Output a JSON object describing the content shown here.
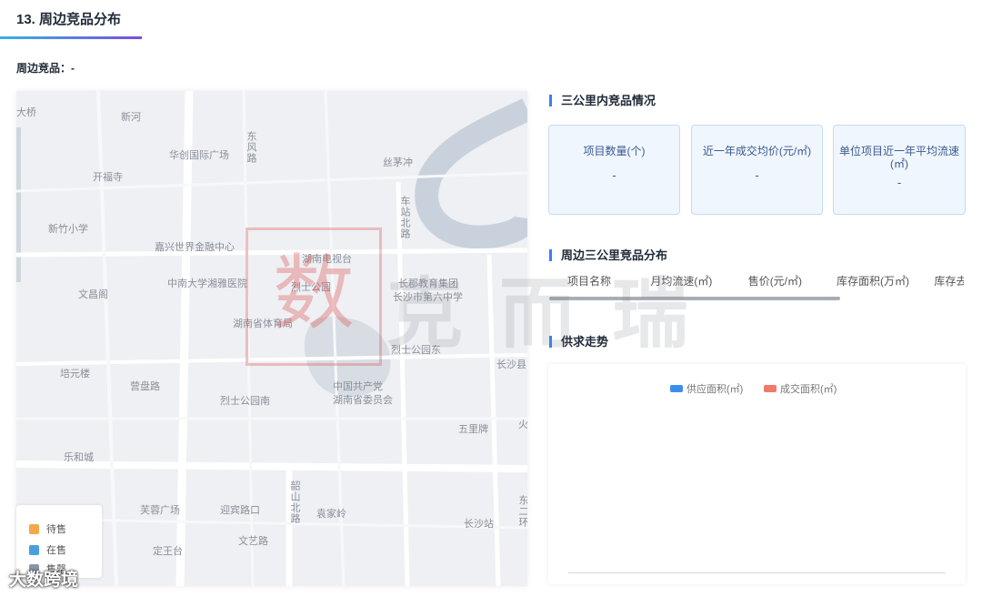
{
  "section": {
    "title": "13. 周边竞品分布"
  },
  "competitor_label": "周边竞品：-",
  "map": {
    "labels": [
      {
        "text": "大桥"
      },
      {
        "text": "新河"
      },
      {
        "text": "华创国际广场"
      },
      {
        "text": "东风路"
      },
      {
        "text": "开福寺"
      },
      {
        "text": "丝茅冲"
      },
      {
        "text": "新竹小学"
      },
      {
        "text": "车站北路"
      },
      {
        "text": "嘉兴世界金融中心"
      },
      {
        "text": "湖南电视台"
      },
      {
        "text": "文昌阁"
      },
      {
        "text": "中南大学湘雅医院"
      },
      {
        "text": "烈士公园"
      },
      {
        "text": "长郡教育集团"
      },
      {
        "text": "长沙市第六中学"
      },
      {
        "text": "湖南省体育局"
      },
      {
        "text": "烈士公园东"
      },
      {
        "text": "长沙县"
      },
      {
        "text": "培元楼"
      },
      {
        "text": "营盘路"
      },
      {
        "text": "中国共产党"
      },
      {
        "text": "湖南省委员会"
      },
      {
        "text": "烈士公园南"
      },
      {
        "text": "火"
      },
      {
        "text": "五里牌"
      },
      {
        "text": "乐和城"
      },
      {
        "text": "韶山北路"
      },
      {
        "text": "芙蓉广场"
      },
      {
        "text": "迎宾路口"
      },
      {
        "text": "袁家岭"
      },
      {
        "text": "长沙站"
      },
      {
        "text": "东二环"
      },
      {
        "text": "文艺路"
      },
      {
        "text": "定王台"
      }
    ],
    "legend": [
      {
        "label": "待售",
        "color": "#f5a84a"
      },
      {
        "label": "在售",
        "color": "#4a9fe0"
      },
      {
        "label": "售罄",
        "color": "#8a96a8"
      }
    ]
  },
  "three_km": {
    "title": "三公里内竞品情况",
    "cards": [
      {
        "label": "项目数量(个)",
        "value": "-"
      },
      {
        "label": "近一年成交均价(元/㎡)",
        "value": "-"
      },
      {
        "label": "单位项目近一年平均流速(㎡)",
        "value": "-"
      }
    ]
  },
  "distribution": {
    "title": "周边三公里竞品分布",
    "columns": [
      "项目名称",
      "月均流速(㎡)",
      "售价(元/㎡)",
      "库存面积(万㎡)",
      "库存去化周期"
    ]
  },
  "supply_demand": {
    "title": "供求走势",
    "legend": [
      {
        "label": "供应面积(㎡)",
        "color": "#3a8ef0"
      },
      {
        "label": "成交面积(㎡)",
        "color": "#f07a6a"
      }
    ]
  },
  "watermark": {
    "seal": "数",
    "text": "克而瑞"
  },
  "corner_brand": "大数跨境"
}
